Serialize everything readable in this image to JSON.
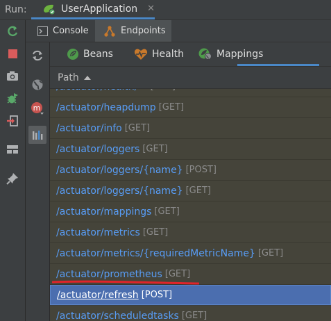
{
  "run": {
    "label": "Run:",
    "tab_title": "UserApplication",
    "close_glyph": "✕"
  },
  "subtabs": {
    "console": "Console",
    "endpoints": "Endpoints"
  },
  "content_tabs": {
    "beans": "Beans",
    "health": "Health",
    "mappings": "Mappings"
  },
  "table": {
    "column_path": "Path",
    "rows": [
      {
        "path": "/actuator/health/**",
        "method": "[GET]"
      },
      {
        "path": "/actuator/heapdump",
        "method": "[GET]"
      },
      {
        "path": "/actuator/info",
        "method": "[GET]"
      },
      {
        "path": "/actuator/loggers",
        "method": "[GET]"
      },
      {
        "path": "/actuator/loggers/{name}",
        "method": "[POST]"
      },
      {
        "path": "/actuator/loggers/{name}",
        "method": "[GET]"
      },
      {
        "path": "/actuator/mappings",
        "method": "[GET]"
      },
      {
        "path": "/actuator/metrics",
        "method": "[GET]"
      },
      {
        "path": "/actuator/metrics/{requiredMetricName}",
        "method": "[GET]"
      },
      {
        "path": "/actuator/prometheus",
        "method": "[GET]"
      },
      {
        "path": "/actuator/refresh",
        "method": "[POST]"
      },
      {
        "path": "/actuator/scheduledtasks",
        "method": "[GET]"
      }
    ]
  },
  "colors": {
    "accent": "#4a88c7",
    "link": "#589df6",
    "selection": "#4b6eaf",
    "row_bg": "#45443a",
    "annotation": "#e0242a"
  }
}
